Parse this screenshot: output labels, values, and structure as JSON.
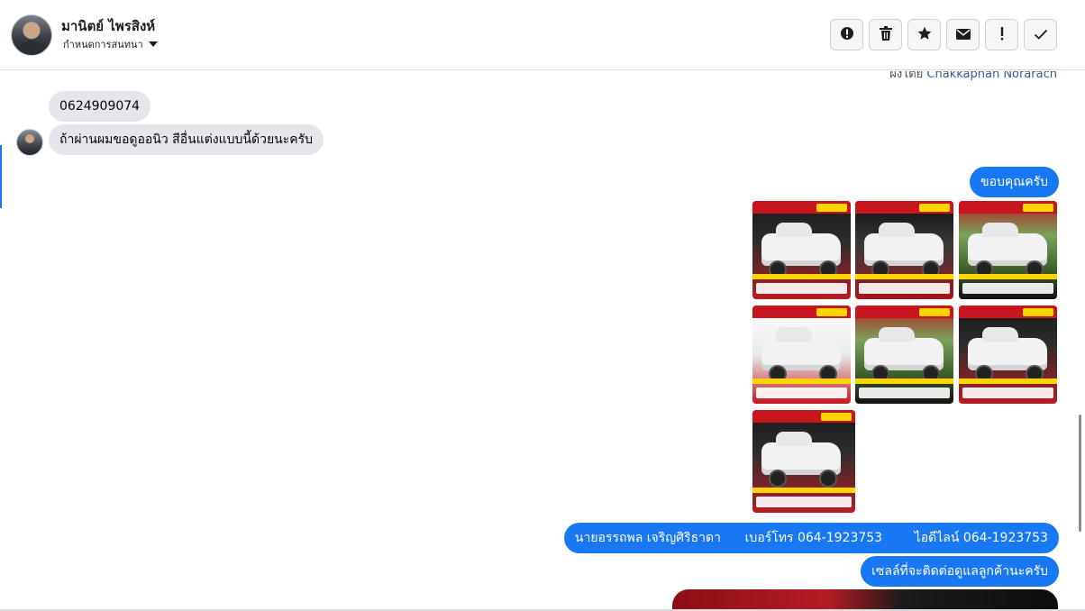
{
  "header": {
    "contact_name": "มานิตย์ ไพรสิงห์",
    "assign_label": "กำหนดการสนทนา",
    "actions": [
      {
        "icon": "alert-circle-icon",
        "glyph": "!"
      },
      {
        "icon": "trash-icon",
        "glyph": ""
      },
      {
        "icon": "star-icon",
        "glyph": "★"
      },
      {
        "icon": "envelope-icon",
        "glyph": "✉"
      },
      {
        "icon": "exclamation-icon",
        "glyph": "!"
      },
      {
        "icon": "checkmark-icon",
        "glyph": "✓"
      }
    ]
  },
  "chat": {
    "credit_prefix": "ผ่งโดย",
    "credit_name": "Chakkaphan Norarach",
    "incoming": [
      {
        "text": "0624909074"
      },
      {
        "text": "ถ้าผ่านผมขอดูออนิว สีอื่นแต่งแบบนี้ด้วยนะครับ"
      }
    ],
    "outgoing_thanks": "ขอบคุณครับ",
    "outgoing_contact": "นายอรรถพล เจริญศิริธาดา      เบอร์โทร 064-1923753        ไอดีไลน์ 064-1923753",
    "outgoing_sales": "เซลล์ที่จะติดต่อดูแลลูกค้านะครับ"
  },
  "colors": {
    "accent": "#1877f2",
    "incoming_bubble": "#e4e6eb",
    "border": "#dadde1"
  }
}
